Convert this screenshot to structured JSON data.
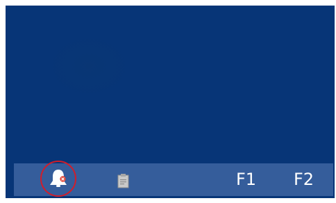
{
  "taskbar": {
    "alarm_icon": "bell-muted-icon",
    "memo_icon": "clipboard-icon",
    "f1_label": "F1",
    "f2_label": "F2"
  },
  "colors": {
    "screen_background": "#073577",
    "taskbar_background": "#355d9b",
    "highlight_circle": "#d21d2a",
    "alarm_badge": "#e0483a"
  }
}
